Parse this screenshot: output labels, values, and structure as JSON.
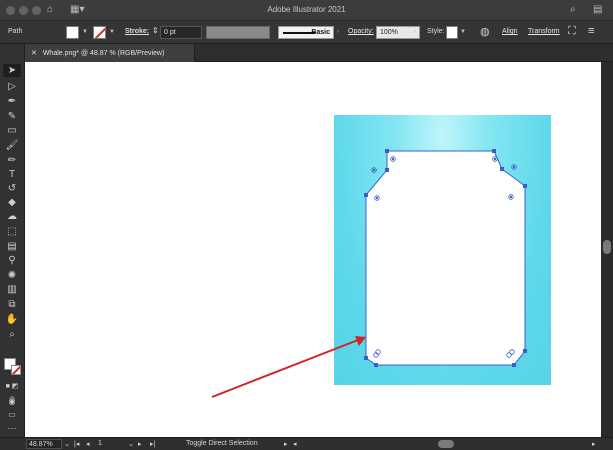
{
  "window": {
    "title": "Adobe Illustrator 2021"
  },
  "control_bar": {
    "object_type": "Path",
    "stroke_label": "Stroke:",
    "stroke_weight": "0 pt",
    "brush_label": "Basic",
    "opacity_label": "Opacity:",
    "opacity_value": "100%",
    "style_label": "Style:",
    "align_label": "Align",
    "transform_label": "Transform"
  },
  "document_tab": {
    "label": "Whale.png* @ 48.87 % (RGB/Preview)"
  },
  "status_bar": {
    "zoom": "48.87%",
    "artboard_number": "1",
    "status_text": "Toggle Direct Selection"
  },
  "colors": {
    "artwork_cyan": "#5ed8ea",
    "path_selection": "#3a5fcd",
    "arrow": "#d0232a"
  },
  "tools": [
    "selection-tool-icon",
    "direct-selection-tool-icon",
    "pen-tool-icon",
    "curvature-tool-icon",
    "rectangle-tool-icon",
    "paintbrush-tool-icon",
    "pencil-tool-icon",
    "type-tool-icon",
    "rotate-tool-icon",
    "eraser-tool-icon",
    "warp-tool-icon",
    "free-transform-tool-icon",
    "gradient-tool-icon",
    "eyedropper-tool-icon",
    "symbol-sprayer-tool-icon",
    "column-graph-tool-icon",
    "artboard-tool-icon",
    "hand-tool-icon",
    "zoom-tool-icon"
  ]
}
